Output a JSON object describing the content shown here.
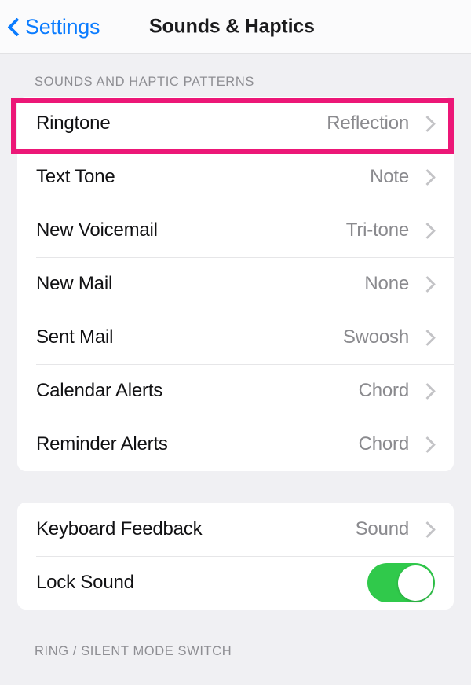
{
  "navbar": {
    "back_label": "Settings",
    "back_icon": "chevron-left-icon",
    "title": "Sounds & Haptics"
  },
  "colors": {
    "accent_blue": "#0b7cff",
    "highlight_magenta": "#ec1777",
    "toggle_on_green": "#30c94b",
    "value_gray": "#8a8a8e",
    "page_background": "#f0f0f3",
    "card_background": "#ffffff"
  },
  "sections": [
    {
      "header": "SOUNDS AND HAPTIC PATTERNS",
      "rows": [
        {
          "label": "Ringtone",
          "value": "Reflection",
          "accessory": "chevron-right-icon",
          "highlighted": true
        },
        {
          "label": "Text Tone",
          "value": "Note",
          "accessory": "chevron-right-icon"
        },
        {
          "label": "New Voicemail",
          "value": "Tri-tone",
          "accessory": "chevron-right-icon"
        },
        {
          "label": "New Mail",
          "value": "None",
          "accessory": "chevron-right-icon"
        },
        {
          "label": "Sent Mail",
          "value": "Swoosh",
          "accessory": "chevron-right-icon"
        },
        {
          "label": "Calendar Alerts",
          "value": "Chord",
          "accessory": "chevron-right-icon"
        },
        {
          "label": "Reminder Alerts",
          "value": "Chord",
          "accessory": "chevron-right-icon"
        }
      ]
    },
    {
      "header": "",
      "rows": [
        {
          "label": "Keyboard Feedback",
          "value": "Sound",
          "accessory": "chevron-right-icon"
        },
        {
          "label": "Lock Sound",
          "value": "",
          "accessory": "toggle-switch",
          "toggle_on": true
        }
      ]
    },
    {
      "header": "RING / SILENT MODE SWITCH",
      "rows": []
    }
  ]
}
